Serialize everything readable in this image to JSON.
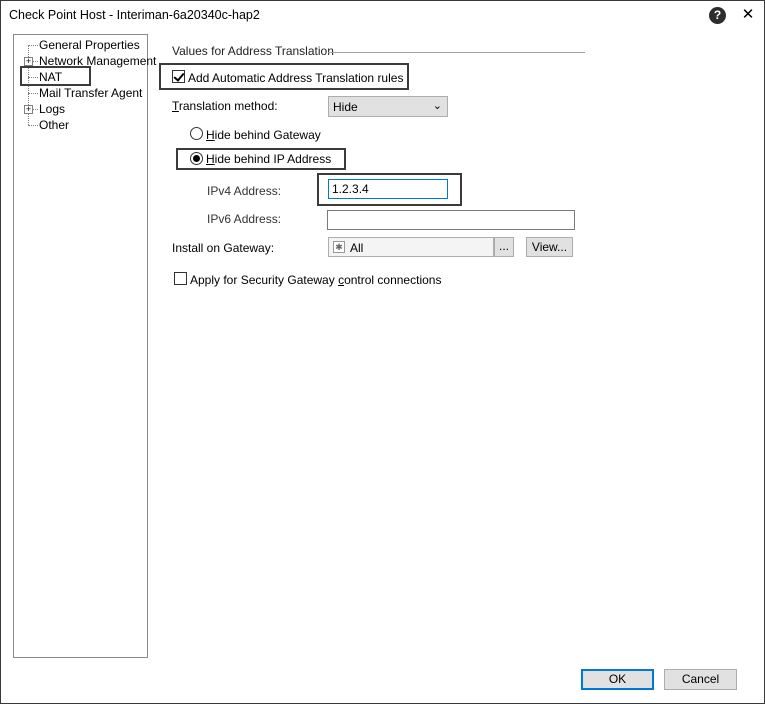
{
  "window": {
    "title": "Check Point Host - Interiman-6a20340c-hap2",
    "help_label": "?",
    "close_label": "✕"
  },
  "sidebar": {
    "items": [
      {
        "label": "General Properties",
        "expandable": false
      },
      {
        "label": "Network Management",
        "expandable": true
      },
      {
        "label": "NAT",
        "expandable": false,
        "selected": true
      },
      {
        "label": "Mail Transfer Agent",
        "expandable": false
      },
      {
        "label": "Logs",
        "expandable": true
      },
      {
        "label": "Other",
        "expandable": false
      }
    ],
    "expander_symbol": "+"
  },
  "nat": {
    "section_title": "Values for Address Translation",
    "auto_rules_label": "Add Automatic Address Translation rules",
    "auto_rules_checked": true,
    "method_label_mn": "T",
    "method_label_rest": "ranslation method:",
    "method_value": "Hide",
    "method_arrow": "⌄",
    "hide_gateway_mn": "H",
    "hide_gateway_rest": "ide behind Gateway",
    "hide_ip_mn": "H",
    "hide_ip_rest": "ide behind IP Address",
    "selected_option": "hide_ip",
    "ipv4_label": "IPv4 Address:",
    "ipv4_value": "1.2.3.4",
    "ipv6_label": "IPv6 Address:",
    "ipv6_value": "",
    "install_label": "Install on Gateway:",
    "install_value": "All",
    "browse_label": "...",
    "view_label": "View...",
    "apply_label_pre": "Apply for Security Gateway ",
    "apply_label_mn": "c",
    "apply_label_post": "ontrol connections",
    "apply_checked": false
  },
  "footer": {
    "ok_label": "OK",
    "cancel_label": "Cancel"
  }
}
